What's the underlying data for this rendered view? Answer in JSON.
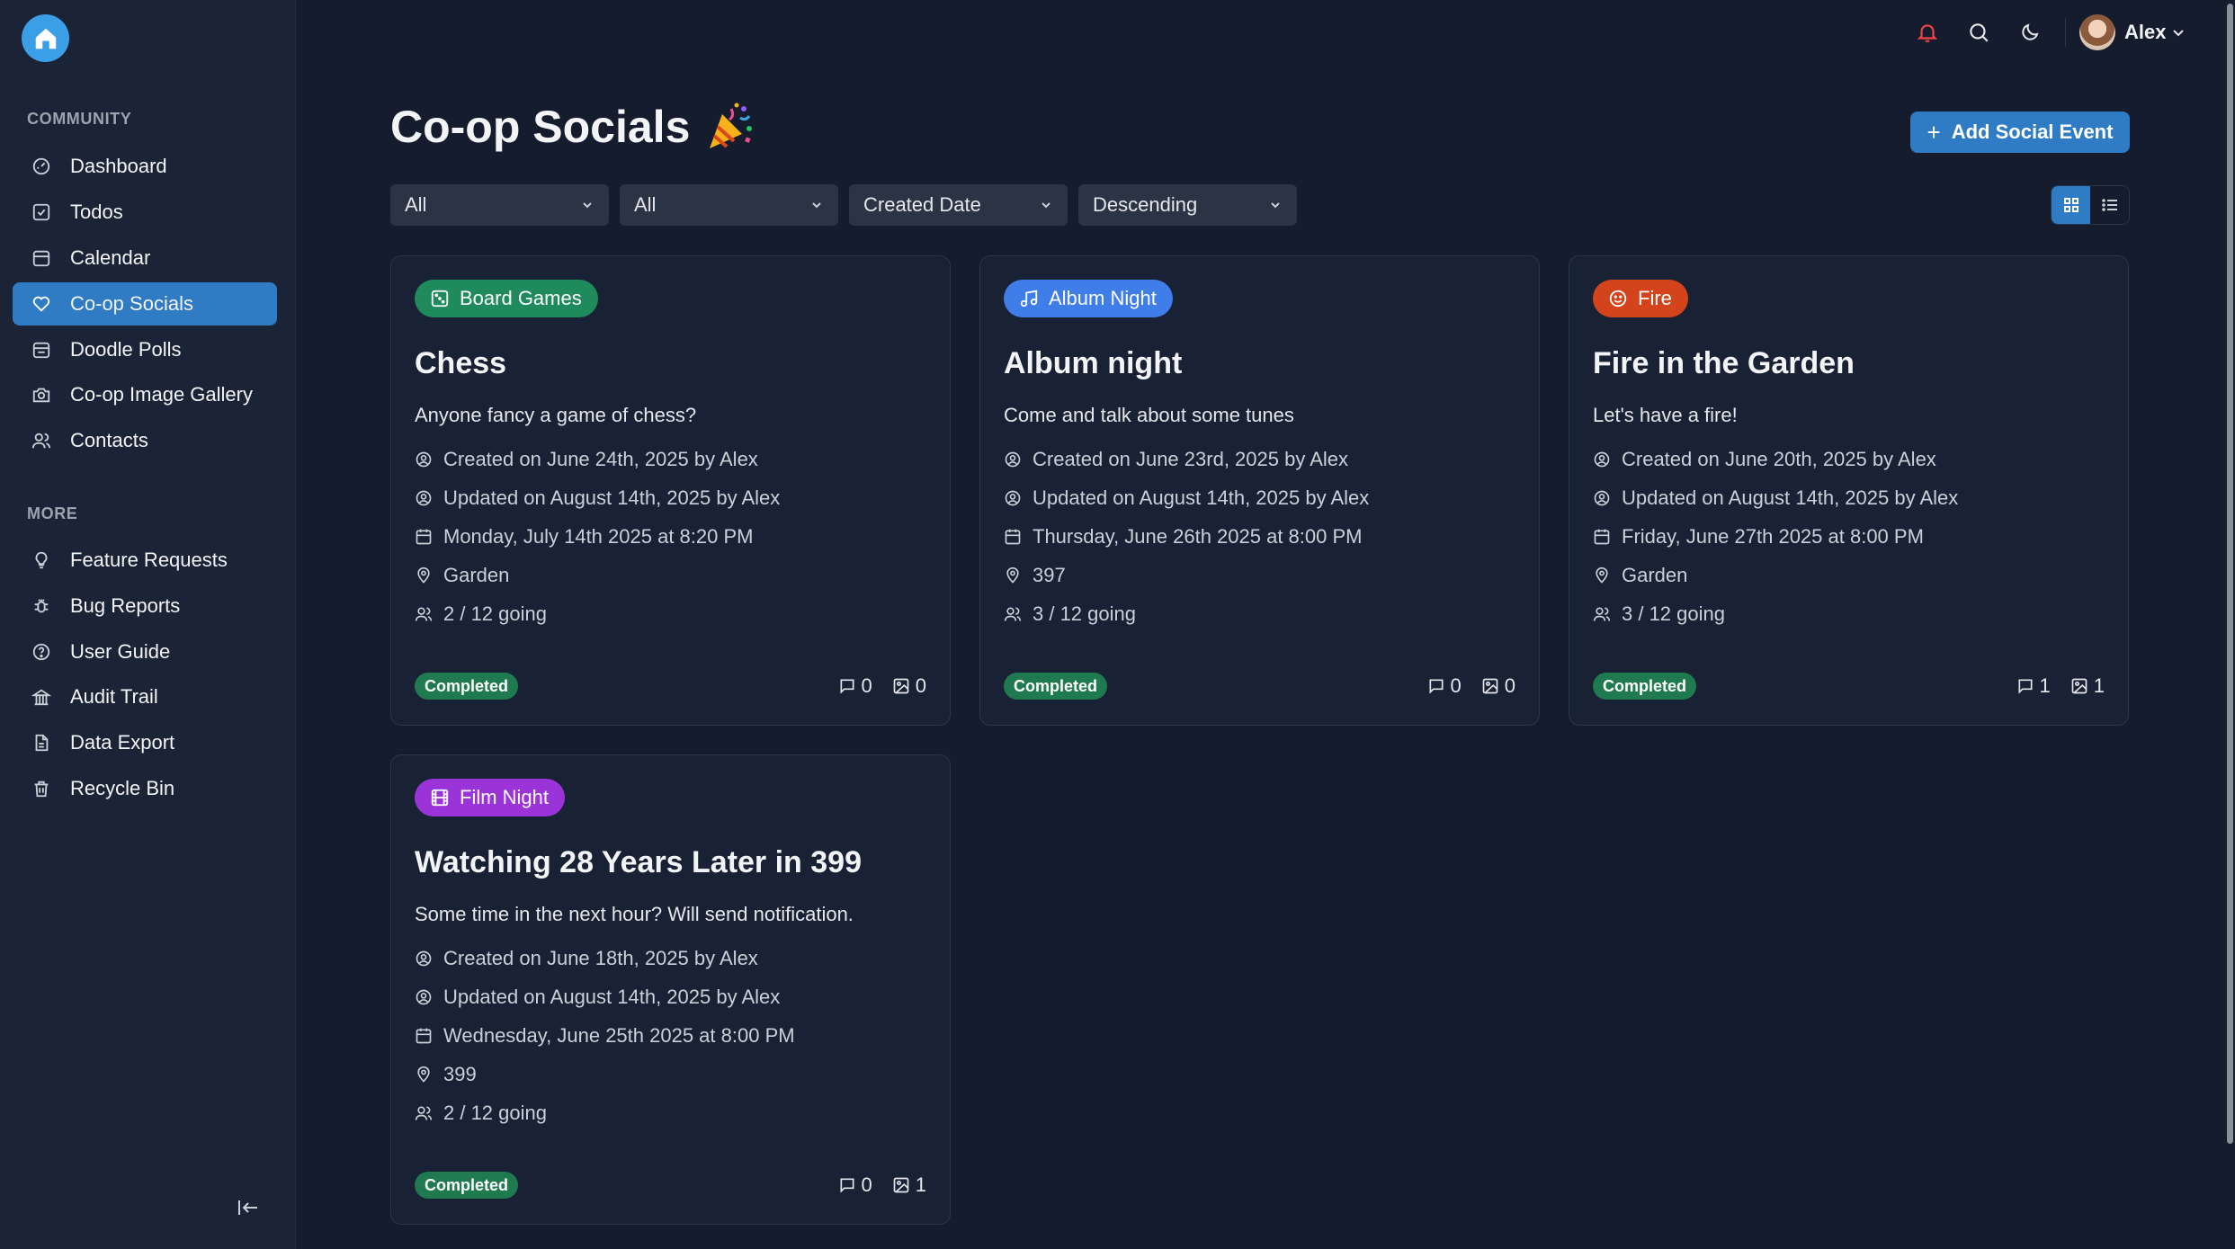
{
  "sidebar": {
    "community_title": "COMMUNITY",
    "more_title": "MORE",
    "community_items": [
      {
        "label": "Dashboard",
        "icon": "dashboard-icon"
      },
      {
        "label": "Todos",
        "icon": "check-square-icon"
      },
      {
        "label": "Calendar",
        "icon": "calendar-icon"
      },
      {
        "label": "Co-op Socials",
        "icon": "heart-icon",
        "active": true
      },
      {
        "label": "Doodle Polls",
        "icon": "calendar-check-icon"
      },
      {
        "label": "Co-op Image Gallery",
        "icon": "camera-icon"
      },
      {
        "label": "Contacts",
        "icon": "users-icon"
      }
    ],
    "more_items": [
      {
        "label": "Feature Requests",
        "icon": "lightbulb-icon"
      },
      {
        "label": "Bug Reports",
        "icon": "bug-icon"
      },
      {
        "label": "User Guide",
        "icon": "help-circle-icon"
      },
      {
        "label": "Audit Trail",
        "icon": "audit-icon"
      },
      {
        "label": "Data Export",
        "icon": "file-export-icon"
      },
      {
        "label": "Recycle Bin",
        "icon": "trash-icon"
      }
    ]
  },
  "topbar": {
    "user_name": "Alex"
  },
  "header": {
    "title": "Co-op Socials",
    "add_button_label": "Add Social Event"
  },
  "filters": {
    "filter1": "All",
    "filter2": "All",
    "sort_by": "Created Date",
    "sort_order": "Descending"
  },
  "colors": {
    "accent": "#2f7bc4",
    "board_games": "#1f8a5b",
    "album_night": "#3f7de8",
    "fire": "#d4441c",
    "film_night": "#9b34d8",
    "completed": "#1f7a4f"
  },
  "cards": [
    {
      "category": "Board Games",
      "title": "Chess",
      "description": "Anyone fancy a game of chess?",
      "created": "Created on June 24th, 2025 by Alex",
      "updated": "Updated on August 14th, 2025 by Alex",
      "date": "Monday, July 14th 2025 at 8:20 PM",
      "location": "Garden",
      "going": "2 / 12 going",
      "status": "Completed",
      "comments": "0",
      "images": "0"
    },
    {
      "category": "Album Night",
      "title": "Album night",
      "description": "Come and talk about some tunes",
      "created": "Created on June 23rd, 2025 by Alex",
      "updated": "Updated on August 14th, 2025 by Alex",
      "date": "Thursday, June 26th 2025 at 8:00 PM",
      "location": "397",
      "going": "3 / 12 going",
      "status": "Completed",
      "comments": "0",
      "images": "0"
    },
    {
      "category": "Fire",
      "title": "Fire in the Garden",
      "description": "Let's have a fire!",
      "created": "Created on June 20th, 2025 by Alex",
      "updated": "Updated on August 14th, 2025 by Alex",
      "date": "Friday, June 27th 2025 at 8:00 PM",
      "location": "Garden",
      "going": "3 / 12 going",
      "status": "Completed",
      "comments": "1",
      "images": "1"
    },
    {
      "category": "Film Night",
      "title": "Watching 28 Years Later in 399",
      "description": "Some time in the next hour? Will send notification.",
      "created": "Created on June 18th, 2025 by Alex",
      "updated": "Updated on August 14th, 2025 by Alex",
      "date": "Wednesday, June 25th 2025 at 8:00 PM",
      "location": "399",
      "going": "2 / 12 going",
      "status": "Completed",
      "comments": "0",
      "images": "1"
    }
  ]
}
